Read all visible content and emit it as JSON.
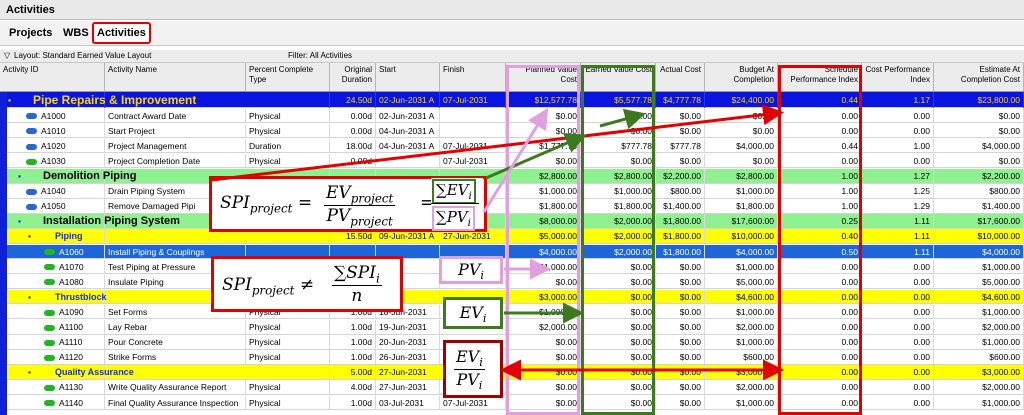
{
  "window": {
    "title": "Activities"
  },
  "tabs": [
    "Projects",
    "WBS",
    "Activities"
  ],
  "layout_label": "Layout: Standard Earned Value Layout",
  "filter_label": "Filter: All Activities",
  "columns": [
    "Activity ID",
    "Activity Name",
    "Percent Complete Type",
    "Original Duration",
    "Start",
    "Finish",
    "Planned Value Cost",
    "Earned Value Cost",
    "Actual Cost",
    "Budget At Completion",
    "Schedule Performance Index",
    "Cost Performance Index",
    "Estimate At Completion Cost"
  ],
  "rows": [
    {
      "type": "proj",
      "id": "",
      "name": "Pipe Repairs & Improvement",
      "pct": "",
      "dur": "24.50d",
      "start": "02-Jun-2031 A",
      "finish": "07-Jul-2031",
      "pv": "$12,577.78",
      "ev": "$5,577.78",
      "ac": "$4,777.78",
      "bac": "$24,400.00",
      "spi": "0.44",
      "cpi": "1.17",
      "eac": "$23,800.00"
    },
    {
      "type": "act",
      "id": "A1000",
      "name": "Contract Award Date",
      "pct": "Physical",
      "dur": "0.00d",
      "start": "02-Jun-2031 A",
      "finish": "",
      "pv": "$0.00",
      "ev": "$0.00",
      "ac": "$0.00",
      "bac": "$0.00",
      "spi": "0.00",
      "cpi": "0.00",
      "eac": "$0.00"
    },
    {
      "type": "act",
      "id": "A1010",
      "name": "Start Project",
      "pct": "Physical",
      "dur": "0.00d",
      "start": "04-Jun-2031 A",
      "finish": "",
      "pv": "$0.00",
      "ev": "$0.00",
      "ac": "$0.00",
      "bac": "$0.00",
      "spi": "0.00",
      "cpi": "0.00",
      "eac": "$0.00"
    },
    {
      "type": "act",
      "id": "A1020",
      "name": "Project Management",
      "pct": "Duration",
      "dur": "18.00d",
      "start": "04-Jun-2031 A",
      "finish": "07-Jul-2031",
      "pv": "$1,777.78",
      "ev": "$777.78",
      "ac": "$777.78",
      "bac": "$4,000.00",
      "spi": "0.44",
      "cpi": "1.00",
      "eac": "$4,000.00"
    },
    {
      "type": "act",
      "id": "A1030",
      "name": "Project Completion Date",
      "pct": "Physical",
      "dur": "0.00d",
      "start": "",
      "finish": "07-Jul-2031",
      "pv": "$0.00",
      "ev": "$0.00",
      "ac": "$0.00",
      "bac": "$0.00",
      "spi": "0.00",
      "cpi": "0.00",
      "eac": "$0.00"
    },
    {
      "type": "wbs1",
      "id": "",
      "name": "Demolition Piping",
      "pct": "",
      "dur": "",
      "start": "",
      "finish": "",
      "pv": "$2,800.00",
      "ev": "$2,800.00",
      "ac": "$2,200.00",
      "bac": "$2,800.00",
      "spi": "1.00",
      "cpi": "1.27",
      "eac": "$2,200.00"
    },
    {
      "type": "act2",
      "id": "A1040",
      "name": "Drain Piping System",
      "pct": "",
      "dur": "",
      "start": "",
      "finish": "",
      "pv": "$1,000.00",
      "ev": "$1,000.00",
      "ac": "$800.00",
      "bac": "$1,000.00",
      "spi": "1.00",
      "cpi": "1.25",
      "eac": "$800.00"
    },
    {
      "type": "act2",
      "id": "A1050",
      "name": "Remove Damaged Pipi",
      "pct": "",
      "dur": "",
      "start": "",
      "finish": "",
      "pv": "$1,800.00",
      "ev": "$1,800.00",
      "ac": "$1,400.00",
      "bac": "$1,800.00",
      "spi": "1.00",
      "cpi": "1.29",
      "eac": "$1,400.00"
    },
    {
      "type": "wbs1",
      "id": "",
      "name": "Installation Piping System",
      "pct": "",
      "dur": "",
      "start": "",
      "finish": "",
      "pv": "$8,000.00",
      "ev": "$2,000.00",
      "ac": "$1,800.00",
      "bac": "$17,600.00",
      "spi": "0.25",
      "cpi": "1.11",
      "eac": "$17,600.00"
    },
    {
      "type": "wbs2",
      "id": "",
      "name": "Piping",
      "pct": "",
      "dur": "15.50d",
      "start": "09-Jun-2031 A",
      "finish": "27-Jun-2031",
      "pv": "$5,000.00",
      "ev": "$2,000.00",
      "ac": "$1,800.00",
      "bac": "$10,000.00",
      "spi": "0.40",
      "cpi": "1.11",
      "eac": "$10,000.00"
    },
    {
      "type": "sel",
      "id": "A1060",
      "name": "Install Piping & Couplings",
      "pct": "",
      "dur": "",
      "start": "",
      "finish": "",
      "pv": "$4,000.00",
      "ev": "$2,000.00",
      "ac": "$1,800.00",
      "bac": "$4,000.00",
      "spi": "0.50",
      "cpi": "1.11",
      "eac": "$4,000.00"
    },
    {
      "type": "act3",
      "id": "A1070",
      "name": "Test Piping at Pressure",
      "pct": "",
      "dur": "",
      "start": "",
      "finish": "",
      "pv": "$1,000.00",
      "ev": "$0.00",
      "ac": "$0.00",
      "bac": "$1,000.00",
      "spi": "0.00",
      "cpi": "0.00",
      "eac": "$1,000.00"
    },
    {
      "type": "act3",
      "id": "A1080",
      "name": "Insulate Piping",
      "pct": "",
      "dur": "",
      "start": "",
      "finish": "",
      "pv": "$0.00",
      "ev": "$0.00",
      "ac": "$0.00",
      "bac": "$5,000.00",
      "spi": "0.00",
      "cpi": "0.00",
      "eac": "$5,000.00"
    },
    {
      "type": "wbs2",
      "id": "",
      "name": "Thrustblock",
      "pct": "",
      "dur": "",
      "start": "",
      "finish": "",
      "pv": "$3,000.00",
      "ev": "$0.00",
      "ac": "$0.00",
      "bac": "$4,600.00",
      "spi": "0.00",
      "cpi": "0.00",
      "eac": "$4,600.00"
    },
    {
      "type": "act3",
      "id": "A1090",
      "name": "Set Forms",
      "pct": "Physical",
      "dur": "1.00d",
      "start": "18-Jun-2031",
      "finish": "",
      "pv": "$1,000.00",
      "ev": "$0.00",
      "ac": "$0.00",
      "bac": "$1,000.00",
      "spi": "0.00",
      "cpi": "0.00",
      "eac": "$1,000.00"
    },
    {
      "type": "act3",
      "id": "A1100",
      "name": "Lay Rebar",
      "pct": "Physical",
      "dur": "1.00d",
      "start": "19-Jun-2031",
      "finish": "",
      "pv": "$2,000.00",
      "ev": "$0.00",
      "ac": "$0.00",
      "bac": "$2,000.00",
      "spi": "0.00",
      "cpi": "0.00",
      "eac": "$2,000.00"
    },
    {
      "type": "act3",
      "id": "A1110",
      "name": "Pour Concrete",
      "pct": "Physical",
      "dur": "1.00d",
      "start": "20-Jun-2031",
      "finish": "",
      "pv": "$0.00",
      "ev": "$0.00",
      "ac": "$0.00",
      "bac": "$1,000.00",
      "spi": "0.00",
      "cpi": "0.00",
      "eac": "$1,000.00"
    },
    {
      "type": "act3",
      "id": "A1120",
      "name": "Strike Forms",
      "pct": "Physical",
      "dur": "1.00d",
      "start": "26-Jun-2031",
      "finish": "",
      "pv": "$0.00",
      "ev": "$0.00",
      "ac": "$0.00",
      "bac": "$600.00",
      "spi": "0.00",
      "cpi": "0.00",
      "eac": "$600.00"
    },
    {
      "type": "wbs2",
      "id": "",
      "name": "Quality Assurance",
      "pct": "",
      "dur": "5.00d",
      "start": "27-Jun-2031",
      "finish": "",
      "pv": "$0.00",
      "ev": "$0.00",
      "ac": "$0.00",
      "bac": "$3,000.00",
      "spi": "0.00",
      "cpi": "0.00",
      "eac": "$3,000.00"
    },
    {
      "type": "act3",
      "id": "A1130",
      "name": "Write Quality Assurance Report",
      "pct": "Physical",
      "dur": "4.00d",
      "start": "27-Jun-2031",
      "finish": "",
      "pv": "$0.00",
      "ev": "$0.00",
      "ac": "$0.00",
      "bac": "$2,000.00",
      "spi": "0.00",
      "cpi": "0.00",
      "eac": "$2,000.00"
    },
    {
      "type": "act3",
      "id": "A1140",
      "name": "Final Quality Assurance Inspection",
      "pct": "Physical",
      "dur": "1.00d",
      "start": "03-Jul-2031",
      "finish": "07-Jul-2031",
      "pv": "$0.00",
      "ev": "$0.00",
      "ac": "$0.00",
      "bac": "$1,000.00",
      "spi": "0.00",
      "cpi": "0.00",
      "eac": "$1,000.00"
    }
  ],
  "colors": {
    "spi_box": "#e00000",
    "ev_box": "#3d7a1f",
    "pv_box": "#e0a0e0",
    "project_row": "#0a14e0",
    "wbs_green": "#8ef08e",
    "wbs_yellow": "#ffff00",
    "selected": "#1e66d8"
  },
  "formulas": {
    "spi_project_def": "SPI_project = EV_project / PV_project = ΣEV_i / ΣPV_i",
    "spi_project_neq": "SPI_project ≠ ΣSPI_i / n",
    "pv_label": "PV_i",
    "ev_label": "EV_i",
    "spi_label": "EV_i / PV_i"
  }
}
